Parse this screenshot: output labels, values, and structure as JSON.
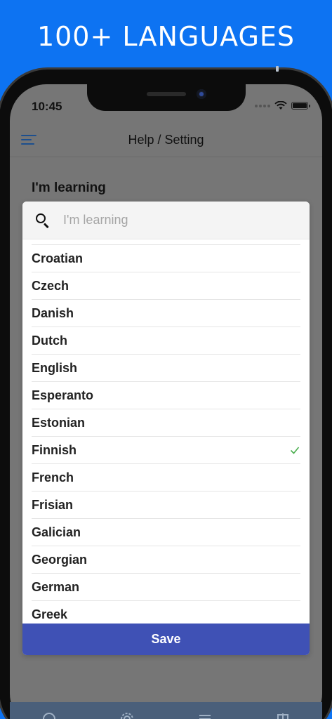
{
  "banner": {
    "headline": "100+ LANGUAGES"
  },
  "status_bar": {
    "time": "10:45"
  },
  "header": {
    "title": "Help / Setting",
    "menu_icon": "hamburger-menu-icon"
  },
  "section": {
    "label": "I'm learning"
  },
  "dialog": {
    "search": {
      "placeholder": "I'm learning",
      "value": ""
    },
    "languages": [
      {
        "label": "Croatian",
        "selected": false
      },
      {
        "label": "Czech",
        "selected": false
      },
      {
        "label": "Danish",
        "selected": false
      },
      {
        "label": "Dutch",
        "selected": false
      },
      {
        "label": "English",
        "selected": false
      },
      {
        "label": "Esperanto",
        "selected": false
      },
      {
        "label": "Estonian",
        "selected": false
      },
      {
        "label": "Finnish",
        "selected": true
      },
      {
        "label": "French",
        "selected": false
      },
      {
        "label": "Frisian",
        "selected": false
      },
      {
        "label": "Galician",
        "selected": false
      },
      {
        "label": "Georgian",
        "selected": false
      },
      {
        "label": "German",
        "selected": false
      },
      {
        "label": "Greek",
        "selected": false
      }
    ],
    "save_label": "Save"
  },
  "colors": {
    "banner_bg": "#0d73f2",
    "save_button": "#3f51b5",
    "check": "#4caf50",
    "menu_icon": "#1d4f8e"
  },
  "tabbar": {
    "icons": [
      "help-circle-icon",
      "gear-icon",
      "list-icon",
      "export-icon"
    ]
  }
}
